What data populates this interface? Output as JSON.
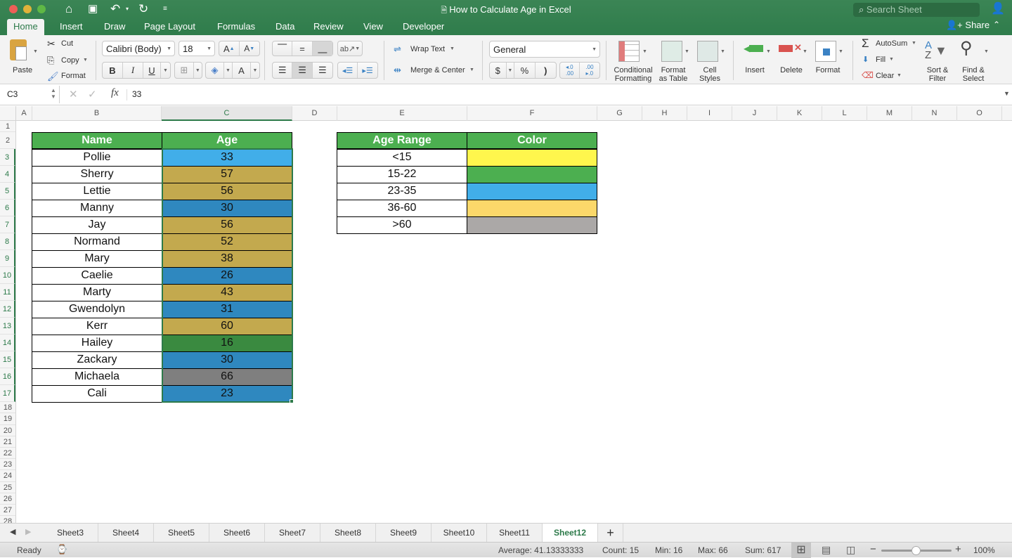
{
  "window": {
    "title": "How to Calculate Age in Excel",
    "search_placeholder": "Search Sheet",
    "share_label": "Share"
  },
  "tabs": [
    {
      "label": "Home",
      "active": true
    },
    {
      "label": "Insert"
    },
    {
      "label": "Draw"
    },
    {
      "label": "Page Layout"
    },
    {
      "label": "Formulas"
    },
    {
      "label": "Data"
    },
    {
      "label": "Review"
    },
    {
      "label": "View"
    },
    {
      "label": "Developer"
    }
  ],
  "ribbon": {
    "paste": "Paste",
    "cut": "Cut",
    "copy": "Copy",
    "format_painter": "Format",
    "font_name": "Calibri (Body)",
    "font_size": "18",
    "bold": "B",
    "italic": "I",
    "underline": "U",
    "wrap_text": "Wrap Text",
    "merge_center": "Merge & Center",
    "number_format": "General",
    "currency": "$",
    "percent": "%",
    "comma": ")",
    "conditional_formatting": [
      "Conditional",
      "Formatting"
    ],
    "format_as_table": [
      "Format",
      "as Table"
    ],
    "cell_styles": [
      "Cell",
      "Styles"
    ],
    "insert": "Insert",
    "delete": "Delete",
    "format": "Format",
    "autosum": "AutoSum",
    "fill": "Fill",
    "clear": "Clear",
    "sort_filter": [
      "Sort &",
      "Filter"
    ],
    "find_select": [
      "Find &",
      "Select"
    ]
  },
  "formula_bar": {
    "name_box": "C3",
    "fx": "fx",
    "value": "33"
  },
  "columns": [
    "A",
    "B",
    "C",
    "D",
    "E",
    "F",
    "G",
    "H",
    "I",
    "J",
    "K",
    "L",
    "M",
    "N",
    "O"
  ],
  "selected_column": "C",
  "rows": [
    "1",
    "2",
    "3",
    "4",
    "5",
    "6",
    "7",
    "8",
    "9",
    "10",
    "11",
    "12",
    "13",
    "14",
    "15",
    "16",
    "17",
    "18",
    "19",
    "20",
    "21",
    "22",
    "23",
    "24",
    "25",
    "26",
    "27",
    "28"
  ],
  "table1": {
    "headers": [
      "Name",
      "Age"
    ],
    "rows": [
      {
        "name": "Pollie",
        "age": "33",
        "color": "#41aee9"
      },
      {
        "name": "Sherry",
        "age": "57",
        "color": "#c3a94e"
      },
      {
        "name": "Lettie",
        "age": "56",
        "color": "#c3a94e"
      },
      {
        "name": "Manny",
        "age": "30",
        "color": "#2f88bf"
      },
      {
        "name": "Jay",
        "age": "56",
        "color": "#c3a94e"
      },
      {
        "name": "Normand",
        "age": "52",
        "color": "#c3a94e"
      },
      {
        "name": "Mary",
        "age": "38",
        "color": "#c3a94e"
      },
      {
        "name": "Caelie",
        "age": "26",
        "color": "#2f88bf"
      },
      {
        "name": "Marty",
        "age": "43",
        "color": "#c3a94e"
      },
      {
        "name": "Gwendolyn",
        "age": "31",
        "color": "#2f88bf"
      },
      {
        "name": "Kerr",
        "age": "60",
        "color": "#c3a94e"
      },
      {
        "name": "Hailey",
        "age": "16",
        "color": "#3a8a40"
      },
      {
        "name": "Zackary",
        "age": "30",
        "color": "#2f88bf"
      },
      {
        "name": "Michaela",
        "age": "66",
        "color": "#7f7f7f"
      },
      {
        "name": "Cali",
        "age": "23",
        "color": "#2f88bf"
      }
    ]
  },
  "table2": {
    "headers": [
      "Age Range",
      "Color"
    ],
    "rows": [
      {
        "range": "<15",
        "color": "#fff64d"
      },
      {
        "range": "15-22",
        "color": "#4caf50"
      },
      {
        "range": "23-35",
        "color": "#41aee9"
      },
      {
        "range": "36-60",
        "color": "#fcd86a"
      },
      {
        "range": ">60",
        "color": "#aba8a7"
      }
    ]
  },
  "sheets": [
    "Sheet3",
    "Sheet4",
    "Sheet5",
    "Sheet6",
    "Sheet7",
    "Sheet8",
    "Sheet9",
    "Sheet10",
    "Sheet11",
    "Sheet12"
  ],
  "active_sheet": "Sheet12",
  "status": {
    "mode": "Ready",
    "average": "Average: 41.13333333",
    "count": "Count: 15",
    "min": "Min: 16",
    "max": "Max: 66",
    "sum": "Sum: 617",
    "zoom": "100%",
    "zoom_fraction": 0.5
  },
  "colors": {
    "accent": "#2d7a4a",
    "header_green": "#4caf50"
  }
}
